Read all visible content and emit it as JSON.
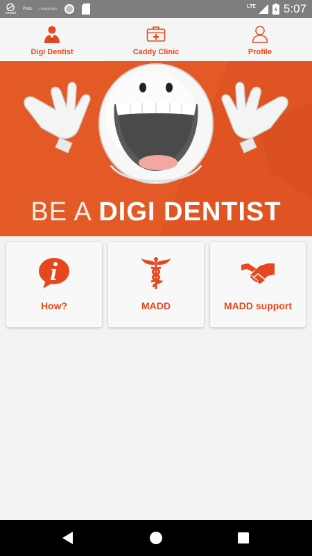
{
  "status_bar": {
    "brand": "smumi",
    "app1": "Plato",
    "app2": "Lenspeople",
    "network": "LTE",
    "time": "5:07"
  },
  "tabs": [
    {
      "label": "Digi Dentist",
      "icon": "dentist-person-icon",
      "active": true
    },
    {
      "label": "Caddy Clinic",
      "icon": "first-aid-kit-icon",
      "active": false
    },
    {
      "label": "Profile",
      "icon": "user-icon",
      "active": false
    }
  ],
  "banner": {
    "title_prefix": "BE A ",
    "title_bold": "DIGI DENTIST",
    "background": "#e35a26"
  },
  "cards": [
    {
      "label": "How?",
      "icon": "info-bubble-icon"
    },
    {
      "label": "MADD",
      "icon": "caduceus-icon"
    },
    {
      "label": "MADD support",
      "icon": "handshake-icon"
    }
  ],
  "colors": {
    "accent": "#e5481e",
    "status_bar": "#7e7e7e",
    "nav_bar": "#000000"
  }
}
